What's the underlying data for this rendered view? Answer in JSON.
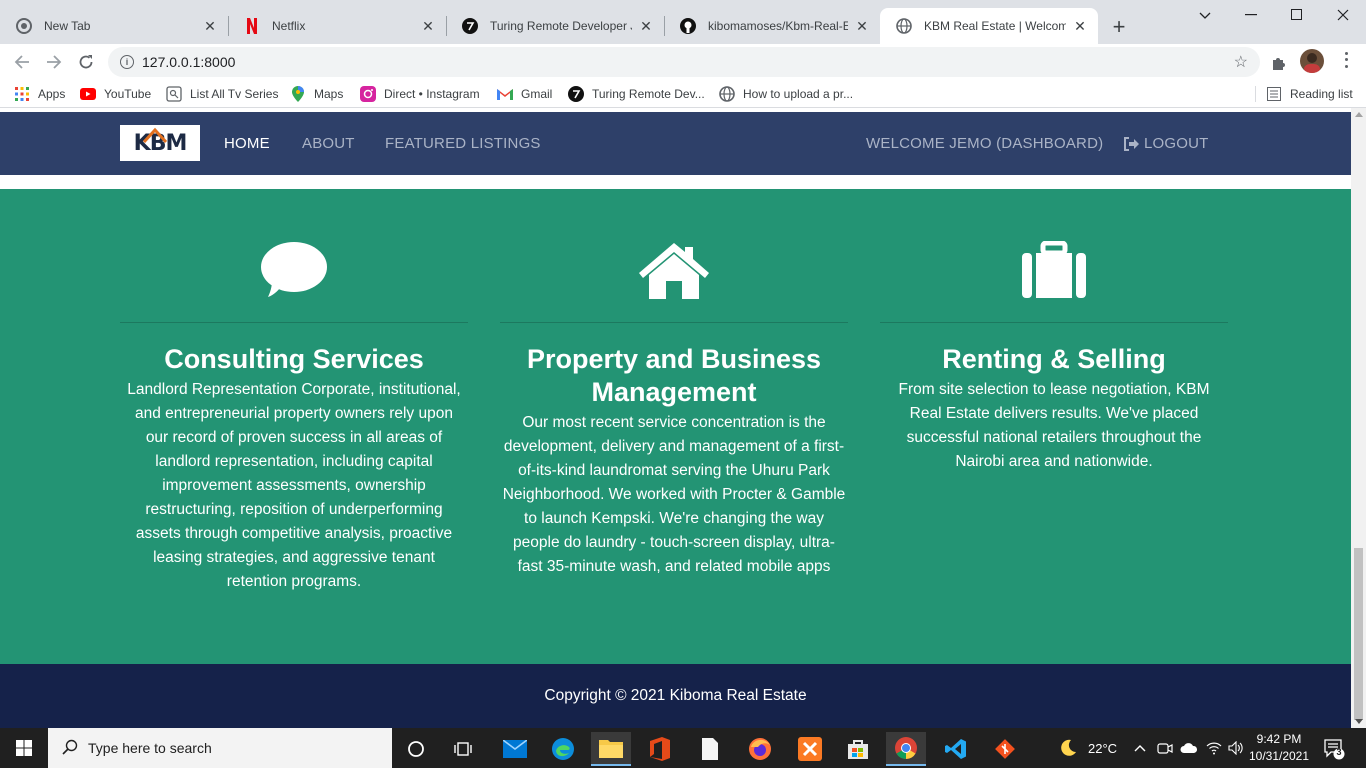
{
  "browser": {
    "tabs": [
      {
        "label": "New Tab",
        "icon": "chrome-icon"
      },
      {
        "label": "Netflix",
        "icon": "netflix-icon"
      },
      {
        "label": "Turing Remote Developer Jo",
        "icon": "turing-icon"
      },
      {
        "label": "kibomamoses/Kbm-Real-Esta",
        "icon": "github-icon"
      },
      {
        "label": "KBM Real Estate | Welcome",
        "icon": "globe-icon",
        "active": true
      }
    ],
    "url": "127.0.0.1:8000",
    "bookmarks": [
      {
        "label": "Apps",
        "icon": "apps-grid-icon"
      },
      {
        "label": "YouTube",
        "icon": "youtube-icon"
      },
      {
        "label": "List All Tv Series",
        "icon": "bookmark-page-icon"
      },
      {
        "label": "Maps",
        "icon": "maps-icon"
      },
      {
        "label": "Direct • Instagram",
        "icon": "instagram-icon"
      },
      {
        "label": "Gmail",
        "icon": "gmail-icon"
      },
      {
        "label": "Turing Remote Dev...",
        "icon": "turing-icon"
      },
      {
        "label": "How to upload a pr...",
        "icon": "globe-icon"
      }
    ],
    "reading_list": "Reading list"
  },
  "site": {
    "logo_text": "KBM",
    "nav": {
      "home": "HOME",
      "about": "ABOUT",
      "featured": "FEATURED LISTINGS",
      "dashboard": "WELCOME JEMO (DASHBOARD)",
      "logout": "LOGOUT"
    },
    "services": [
      {
        "icon": "comment-icon",
        "title": "Consulting Services",
        "text": "Landlord Representation Corporate, institutional, and entrepreneurial property owners rely upon our record of proven success in all areas of landlord representation, including capital improvement assessments, ownership restructuring, reposition of underperforming assets through competitive analysis, proactive leasing strategies, and aggressive tenant retention programs."
      },
      {
        "icon": "home-icon",
        "title": "Property and Business Management",
        "text": "Our most recent service concentration is the development, delivery and management of a first-of-its-kind laundromat serving the Uhuru Park Neighborhood. We worked with Procter & Gamble to launch Kempski. We're changing the way people do laundry - touch-screen display, ultra-fast 35-minute wash, and related mobile apps"
      },
      {
        "icon": "suitcase-icon",
        "title": "Renting & Selling",
        "text": "From site selection to lease negotiation, KBM Real Estate delivers results. We've placed successful national retailers throughout the Nairobi area and nationwide."
      }
    ],
    "footer": "Copyright © 2021 Kiboma Real Estate",
    "colors": {
      "nav_bg": "#2e4069",
      "services_bg": "#239474",
      "footer_bg": "#15224a"
    }
  },
  "taskbar": {
    "search_placeholder": "Type here to search",
    "temperature": "22°C",
    "time": "9:42 PM",
    "date": "10/31/2021",
    "notifications": "3"
  }
}
